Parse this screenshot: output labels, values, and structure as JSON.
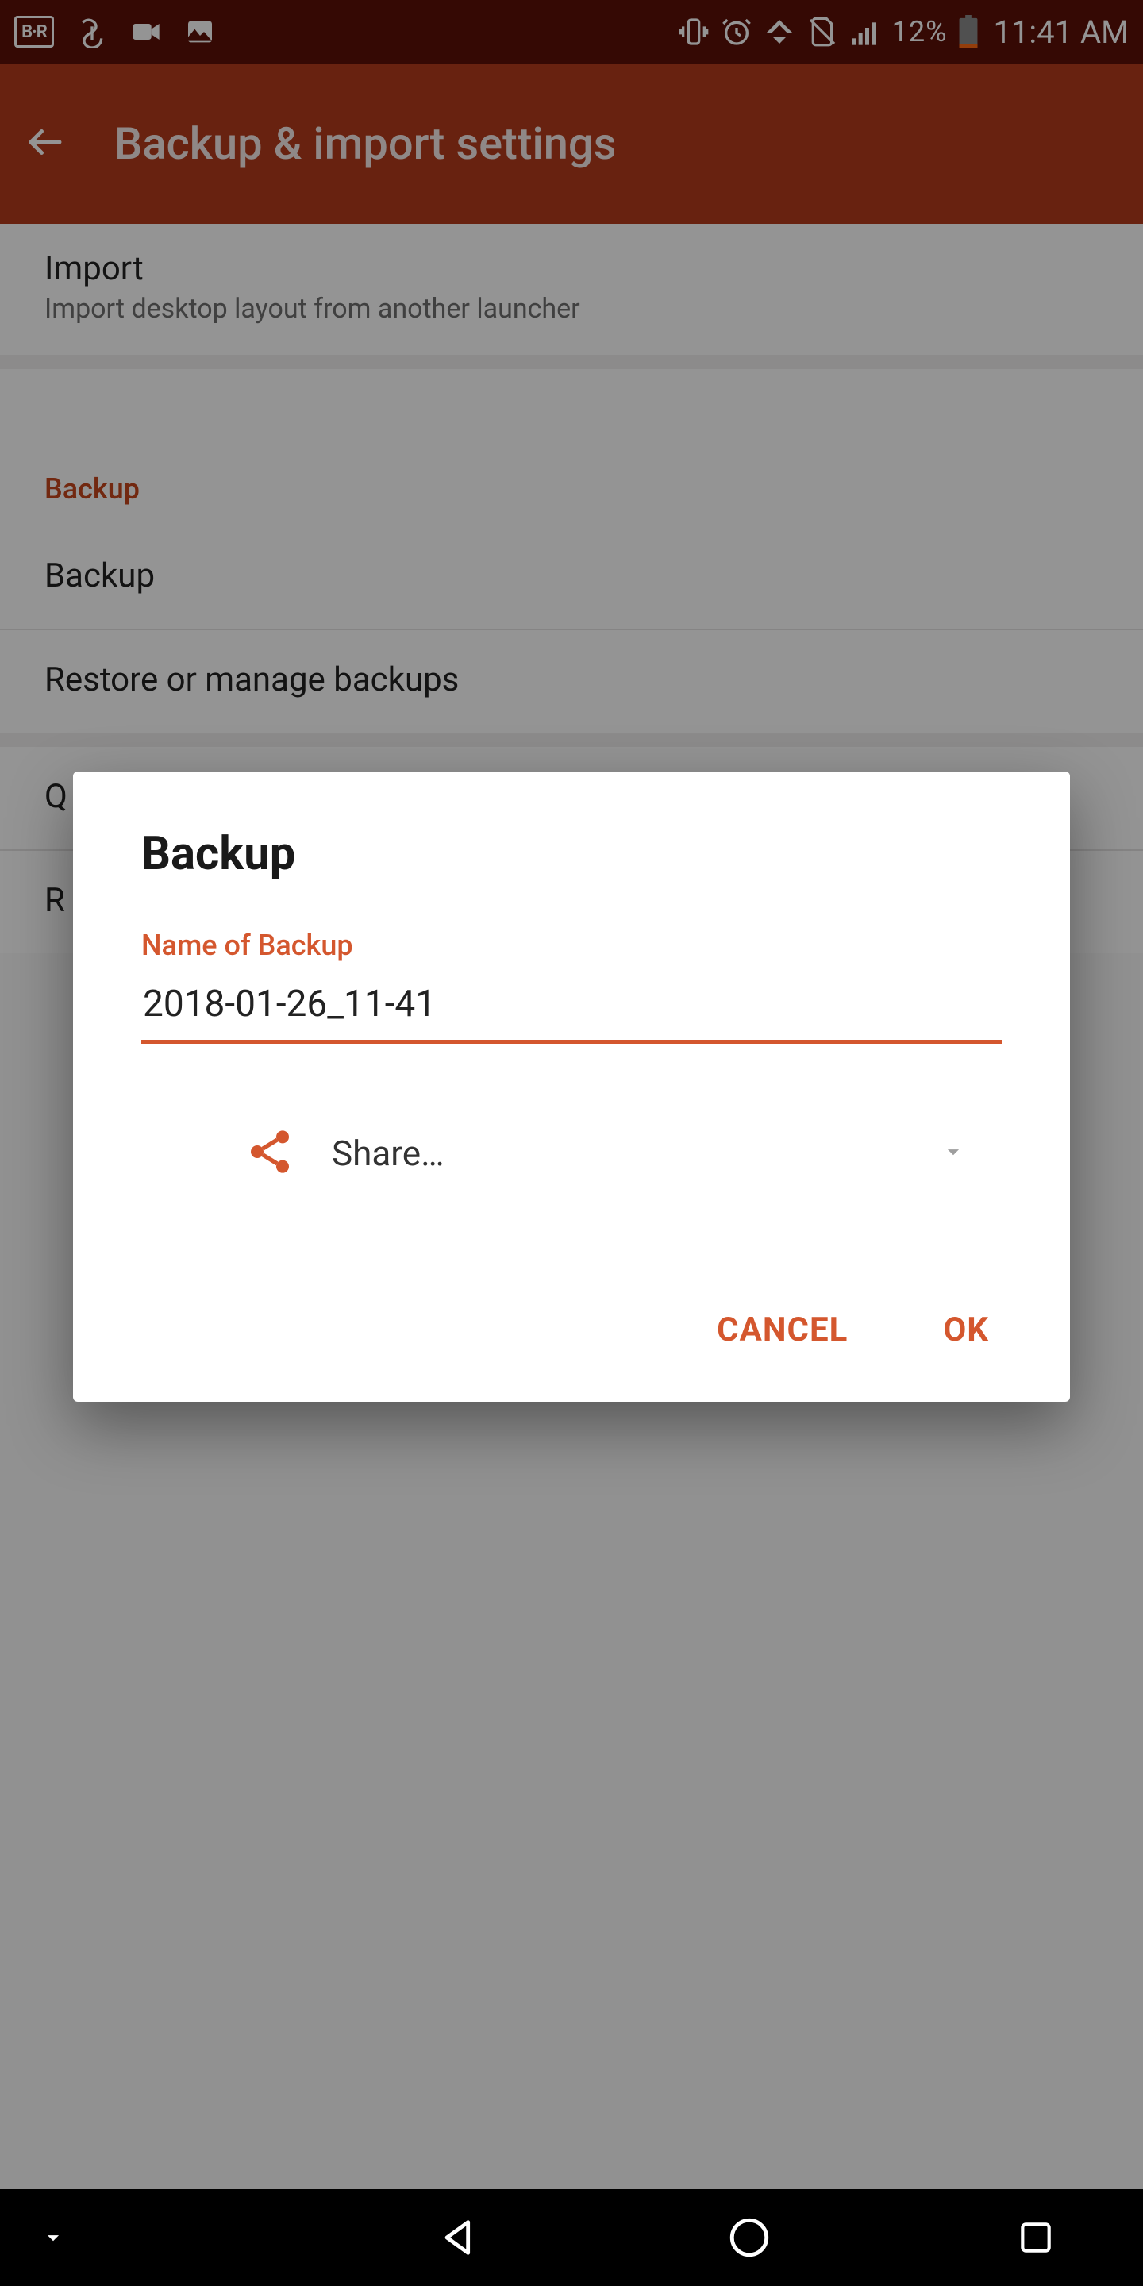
{
  "status": {
    "battery_pct": "12%",
    "clock": "11:41 AM"
  },
  "header": {
    "title": "Backup & import settings"
  },
  "list": {
    "import": {
      "title": "Import",
      "subtitle": "Import desktop layout from another launcher"
    },
    "section_backup": "Backup",
    "backup": "Backup",
    "restore": "Restore or manage backups",
    "quick": "Q",
    "reset": "R"
  },
  "dialog": {
    "title": "Backup",
    "field_label": "Name of Backup",
    "field_value": "2018-01-26_11-41",
    "share_label": "Share…",
    "cancel": "CANCEL",
    "ok": "OK"
  }
}
